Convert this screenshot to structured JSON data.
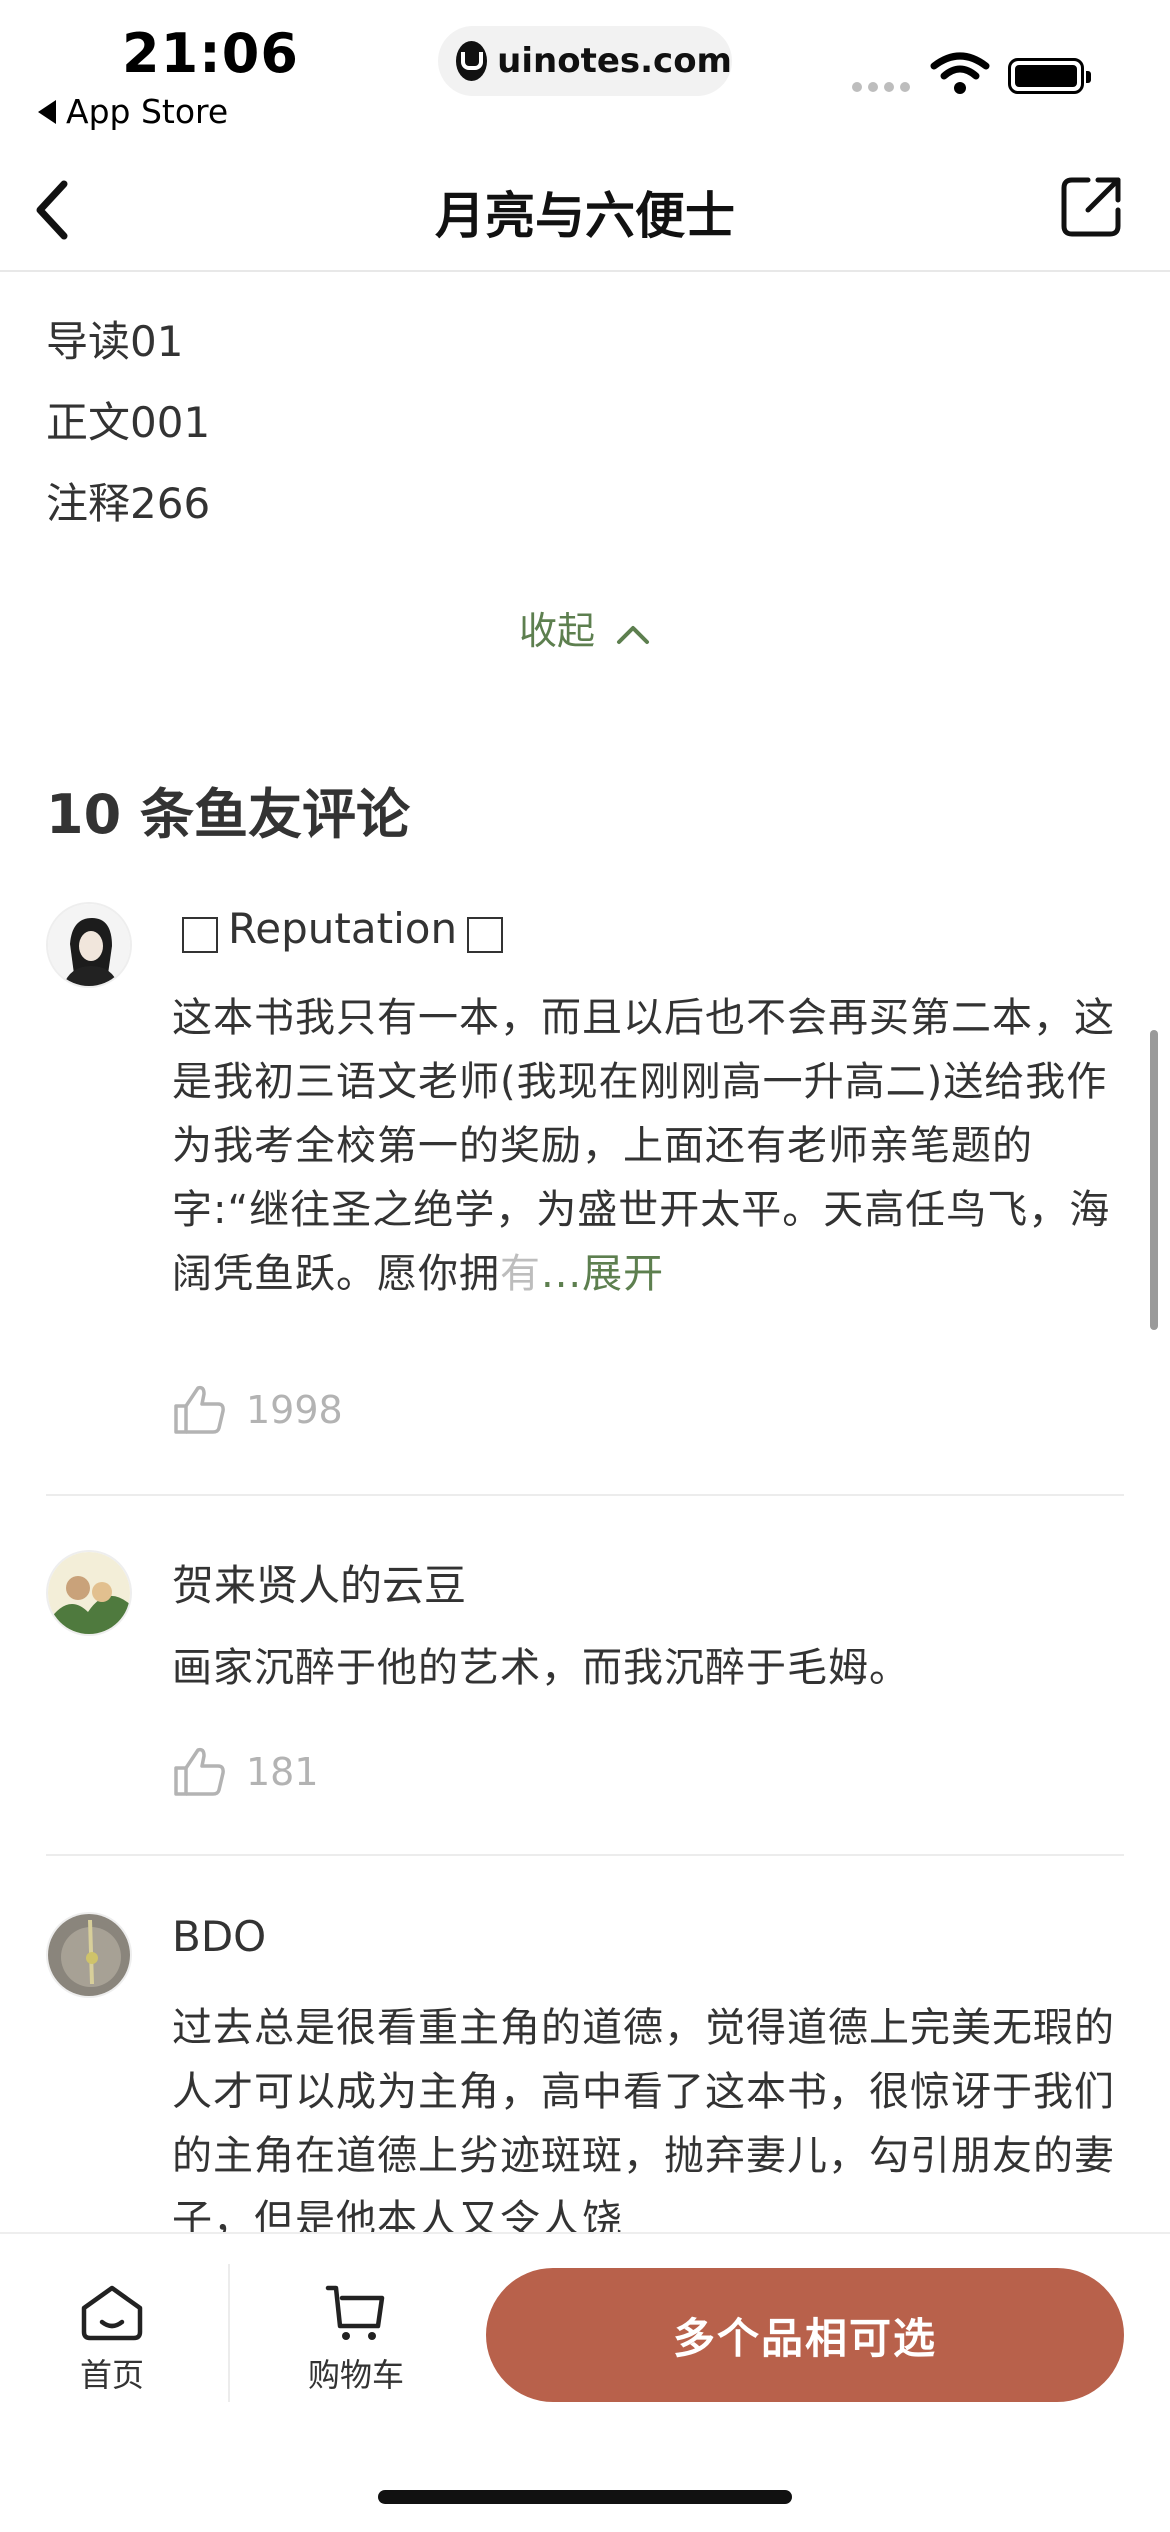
{
  "status_bar": {
    "time": "21:06",
    "back_app": "App Store",
    "url": "uinotes.com"
  },
  "nav": {
    "title": "月亮与六便士",
    "back_icon": "chevron-left-icon",
    "share_icon": "share-icon"
  },
  "toc": {
    "items": [
      "导读01",
      "正文001",
      "注释266"
    ],
    "collapse_label": "收起"
  },
  "comments_section": {
    "title": "10 条鱼友评论"
  },
  "comments": [
    {
      "user": "Reputation",
      "text": "这本书我只有一本，而且以后也不会再买第二本，这是我初三语文老师(我现在刚刚高一升高二)送给我作为我考全校第一的奖励，上面还有老师亲笔题的字:“继往圣之绝学，为盛世开太平。天高任鸟飞，海阔凭鱼跃。愿你拥",
      "text_fade": "有",
      "expand": "...展开",
      "likes": "1998"
    },
    {
      "user": "贺来贤人的云豆",
      "text": "画家沉醉于他的艺术，而我沉醉于毛姆。",
      "likes": "181"
    },
    {
      "user": "BDO",
      "text": "过去总是很看重主角的道德，觉得道德上完美无瑕的人才可以成为主角，高中看了这本书，很惊讶于我们的主角在道德上劣迹斑斑，抛弃妻儿，勾引朋友的妻子，但是他本人又令人饶"
    }
  ],
  "bottom_bar": {
    "home_label": "首页",
    "cart_label": "购物车",
    "cta_label": "多个品相可选"
  },
  "colors": {
    "accent_green": "#5d7f4f",
    "cta": "#b8614b"
  }
}
